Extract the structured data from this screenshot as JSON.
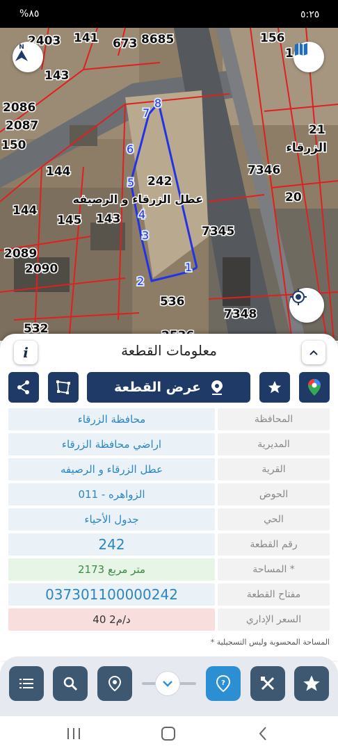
{
  "status_bar": {
    "time": "٥:٢٥",
    "indicators": "%٨٥"
  },
  "map": {
    "parcel_numbers": [
      "2403",
      "141",
      "673",
      "8685",
      "156",
      "1",
      "143",
      "2086",
      "2087",
      "150",
      "144",
      "144",
      "145",
      "143",
      "242",
      "7346",
      "20",
      "7345",
      "2089",
      "2090",
      "536",
      "7348",
      "532",
      "2536",
      "21"
    ],
    "area_labels": [
      "عطل الزرقاء و الرصيفه",
      "الزرقاء"
    ],
    "vertex_labels": [
      "1",
      "2",
      "3",
      "4",
      "5",
      "6",
      "7",
      "8"
    ],
    "colors": {
      "parcel_lines": "#e0201f",
      "boundary": "#2233e6",
      "vertex_fill": "#cfe0ff"
    }
  },
  "panel": {
    "title": "معلومات القطعة",
    "info_label": "i",
    "view_parcel_label": "عرض القطعة",
    "rows": [
      {
        "label": "المحافظة",
        "value": "محافظة الزرقاء"
      },
      {
        "label": "المديرية",
        "value": "اراضي محافظة الزرقاء"
      },
      {
        "label": "القرية",
        "value": "عطل الزرقاء و الرصيفه"
      },
      {
        "label": "الحوض",
        "value": "الزواهره - 011"
      },
      {
        "label": "الحي",
        "value": "جدول الأحياء"
      },
      {
        "label": "رقم القطعة",
        "value": "242"
      },
      {
        "label": "المساحة *",
        "value": "2173  متر مربع"
      },
      {
        "label": "مفتاح القطعة",
        "value": "037301100000242"
      },
      {
        "label": "السعر الإداري",
        "value": "40 د/م2"
      }
    ],
    "footnote": "* المساحة المحسوبة وليس التسجيلية"
  },
  "toolbar": {
    "icons": [
      "list-icon",
      "search-icon",
      "location-pin-icon",
      "chevron-down-icon",
      "help-icon",
      "tools-icon",
      "star-icon"
    ]
  },
  "colors": {
    "primary": "#1f3a66",
    "accent": "#2c8fd3",
    "value_text": "#2b86c2"
  }
}
